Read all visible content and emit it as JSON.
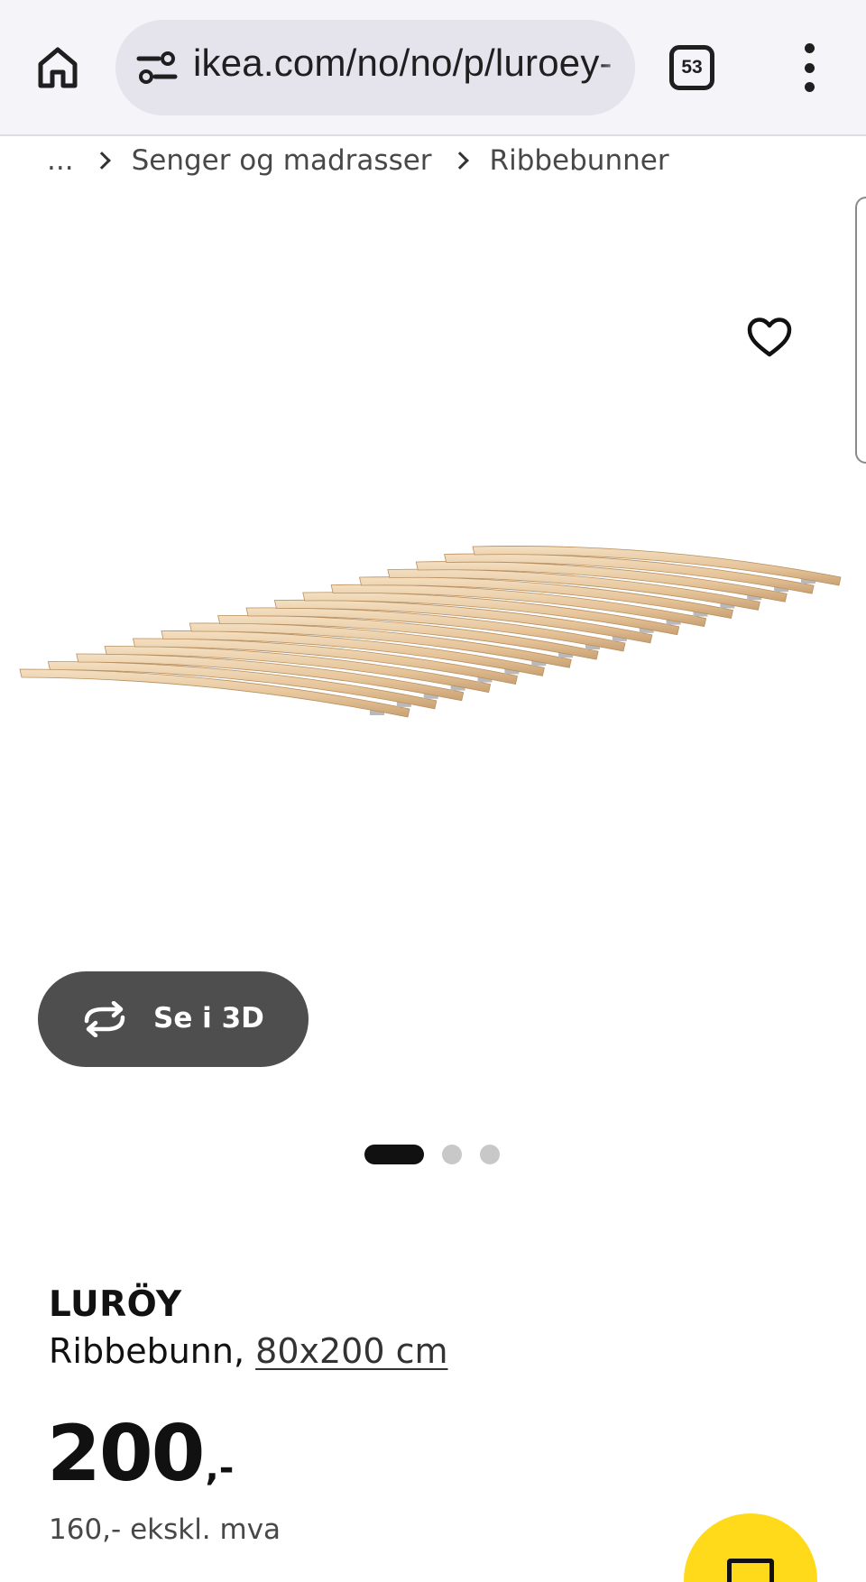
{
  "browser": {
    "url": "ikea.com/no/no/p/luroey-",
    "tab_count": "53"
  },
  "breadcrumb": {
    "ellipsis": "...",
    "items": [
      "Senger og madrasser",
      "Ribbebunner"
    ]
  },
  "gallery": {
    "view_3d_label": "Se i 3D",
    "image_count": 3,
    "active_index": 0
  },
  "product": {
    "name": "LURÖY",
    "type": "Ribbebunn,",
    "size": "80x200 cm",
    "price_integer": "200",
    "price_suffix": ",-",
    "price_excl_vat": "160,- ekskl. mva"
  },
  "icons": {
    "home": "home-icon",
    "site_settings": "tune-icon",
    "tabs": "tab-switcher-icon",
    "menu": "more-vert-icon",
    "favourite": "heart-icon",
    "view_3d": "rotate-3d-icon",
    "cart": "shopping-bag-icon"
  },
  "colors": {
    "chrome_bg": "#f5f4f9",
    "url_pill_bg": "#e5e3ec",
    "view3d_bg": "#4e4e4e",
    "cart_fab": "#ffda1a",
    "slat_wood": "#e8c9a0"
  }
}
